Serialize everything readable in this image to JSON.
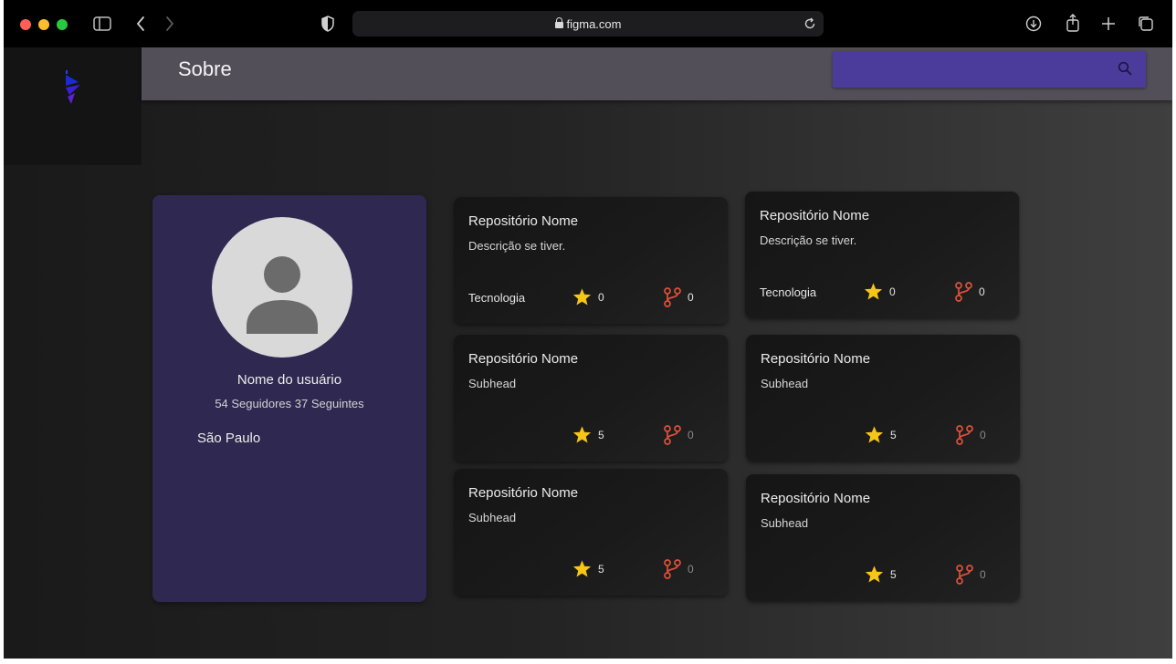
{
  "browser": {
    "url": "figma.com",
    "traffic_lights": [
      "#ff5f57",
      "#febc2e",
      "#28c840"
    ],
    "icons": [
      "sidebar-icon",
      "back-icon",
      "forward-icon",
      "shield-icon",
      "lock-icon",
      "reload-icon",
      "download-icon",
      "share-icon",
      "new-tab-icon",
      "tabs-overview-icon"
    ]
  },
  "header": {
    "title": "Sobre",
    "search_color": "#4b3c9b"
  },
  "profile": {
    "name": "Nome do usuário",
    "stats": "54 Seguidores  37 Seguintes",
    "location": "São Paulo",
    "card_color": "#2f2850"
  },
  "repos": [
    {
      "title": "Repositório Nome",
      "desc": "Descrição se tiver.",
      "tech": "Tecnologia",
      "stars": "0",
      "forks": "0"
    },
    {
      "title": "Repositório Nome",
      "desc": "Descrição se tiver.",
      "tech": "Tecnologia",
      "stars": "0",
      "forks": "0"
    },
    {
      "title": "Repositório Nome",
      "desc": "Subhead",
      "tech": "",
      "stars": "5",
      "forks": "0"
    },
    {
      "title": "Repositório Nome",
      "desc": "Subhead",
      "tech": "",
      "stars": "5",
      "forks": "0"
    },
    {
      "title": "Repositório Nome",
      "desc": "Subhead",
      "tech": "",
      "stars": "5",
      "forks": "0"
    },
    {
      "title": "Repositório Nome",
      "desc": "Subhead",
      "tech": "",
      "stars": "5",
      "forks": "0"
    }
  ],
  "colors": {
    "star": "#f5c518",
    "fork": "#e0503a"
  }
}
